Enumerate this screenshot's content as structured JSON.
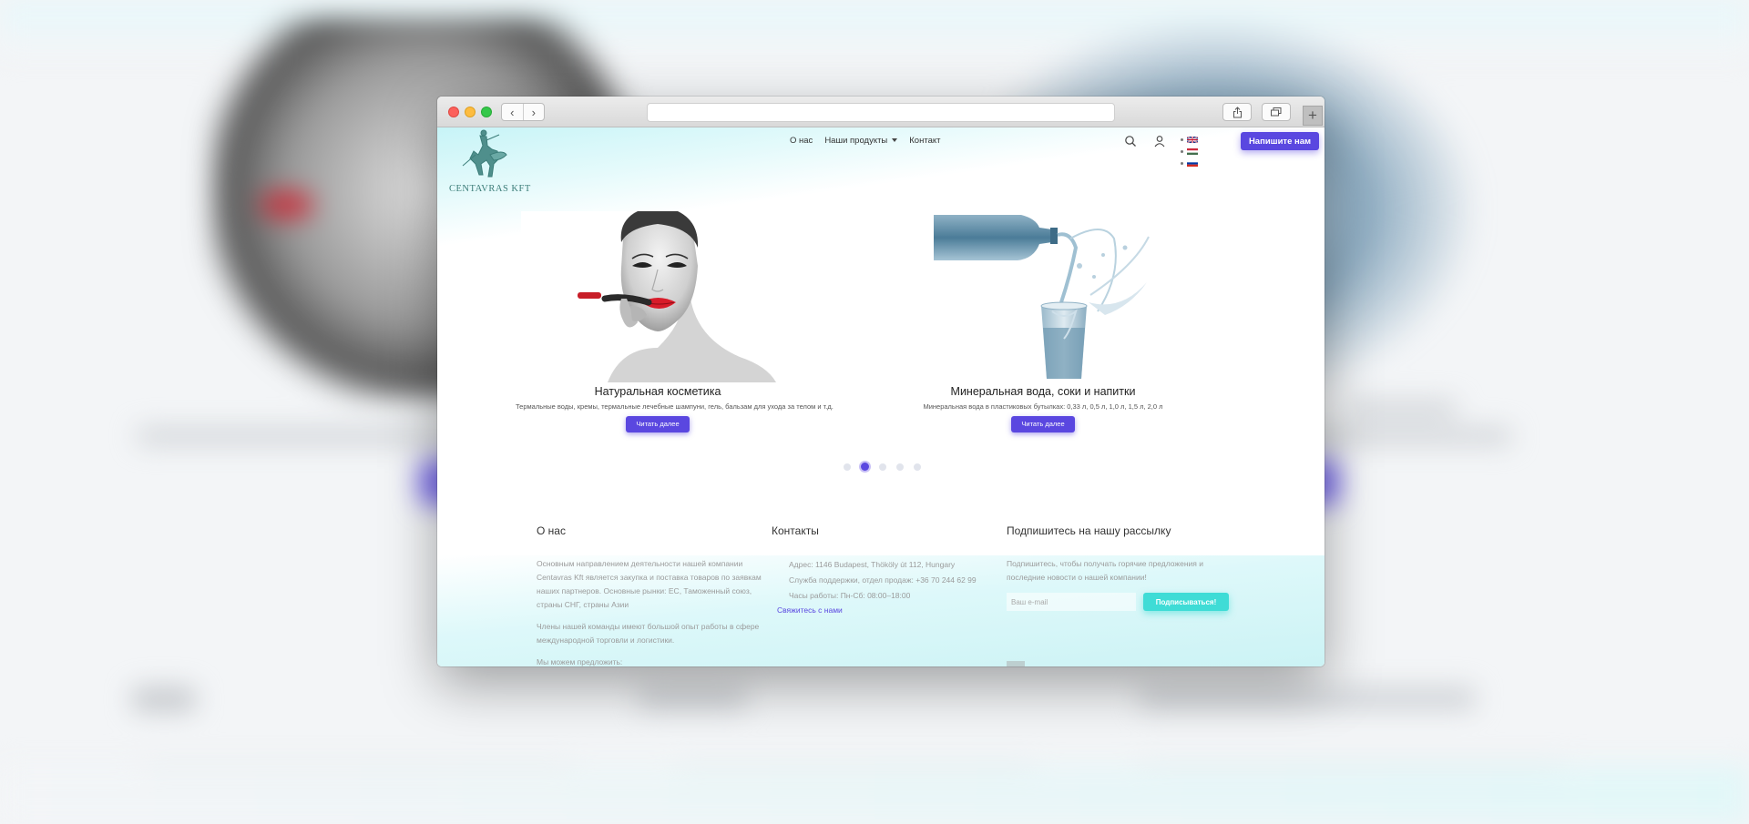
{
  "browser": {
    "back_icon": "‹",
    "forward_icon": "›",
    "newtab_icon": "+"
  },
  "site": {
    "logo_text": "CENTAVRAS KFT",
    "nav": [
      {
        "label": "О нас"
      },
      {
        "label": "Наши продукты",
        "has_dropdown": true
      },
      {
        "label": "Контакт"
      }
    ],
    "languages": [
      "en",
      "hu",
      "ru"
    ],
    "cta_label": "Напишите нам",
    "accent_color": "#5a47e0",
    "secondary_color": "#3fdcd6"
  },
  "slides": [
    {
      "title": "Натуральная косметика",
      "subtitle": "Термальные воды, кремы, термальные лечебные шампуни, гель, бальзам для ухода за телом и т.д.",
      "button": "Читать далее"
    },
    {
      "title": "Минеральная вода, соки и напитки",
      "subtitle": "Минеральная вода в пластиковых бутылках: 0,33 л, 0,5 л, 1,0 л, 1,5 л, 2,0 л",
      "button": "Читать далее"
    }
  ],
  "carousel": {
    "dot_count": 5,
    "active_index": 1
  },
  "footer": {
    "about": {
      "heading": "О нас",
      "p1": "Основным направлением деятельности нашей компании Centavras Kft является закупка и поставка товаров по заявкам наших партнеров. Основные рынки: ЕС, Таможенный союз, страны СНГ, страны Азии",
      "p2": "Члены нашей команды имеют большой опыт работы в сфере международной торговли и логистики.",
      "p3": "Мы можем предложить:"
    },
    "contacts": {
      "heading": "Контакты",
      "address": "Адрес: 1146 Budapest, Thököly út 112, Hungary",
      "support": "Служба поддержки, отдел продаж: +36 70 244 62 99",
      "hours": "Часы работы: Пн-Сб: 08:00–18:00",
      "link": "Свяжитесь с нами"
    },
    "newsletter": {
      "heading": "Подпишитесь на нашу рассылку",
      "text": "Подпишитесь, чтобы получать горячие предложения и последние новости о нашей компании!",
      "email_placeholder": "Ваш e-mail",
      "button": "Подписываться!"
    }
  }
}
